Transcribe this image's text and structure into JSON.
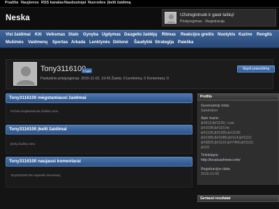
{
  "topnav": {
    "items": [
      "Pradžia",
      "Naujienos",
      "RSS kanalas",
      "Nauduotojai",
      "Nuorodos",
      "Įkelti žaidimą"
    ]
  },
  "header": {
    "logo": "Neska"
  },
  "promo": {
    "title": "Užsiregistruok ir gauk taškų!",
    "subtitle": "Prisijungimas · Registracija"
  },
  "menu": {
    "row1": [
      "Visi žaidimai",
      "Kiti",
      "Veiksmas",
      "Stalo",
      "Gynyba",
      "Ugdymas",
      "Daugelio žaidėjų",
      "Ritmas",
      "Reakcijos greitis",
      "Nuotykis",
      "Kazino",
      "Rengtis"
    ],
    "row2": [
      "Mušimės",
      "Vaidmenų",
      "Sportas",
      "Arkada",
      "Lenktynės",
      "Dėlionė",
      "Šaudyklė",
      "Strategija",
      "Paieška"
    ]
  },
  "profile": {
    "name": "Tony3116100",
    "badge": "0 lygis",
    "stats": "Paskutinis prisijungimas: 2015-11-02, 19:43   Žaista: 0   Įvertinimų: 0   Komentarų: 0",
    "message_button": "Siųsti pranešimą"
  },
  "sections": {
    "favorites_title": "Tony3116100 mėgstamiausi žaidimai",
    "favorites_empty": "Kol kas mėgstamiausių žaidimų nėra",
    "uploaded_title": "Tony3116100 įkelti žaidimai",
    "uploaded_empty": "Įkeltų žaidimų nėra",
    "comments_title": "Tony3116100 naujausi komentarai",
    "comments_empty": "Tony3116100 dar neparašė komentarų"
  },
  "sidebar": {
    "profile_title": "Profilis",
    "city_label": "Gyvenamoji vieta:",
    "city_value": "Sandviken",
    "about_label": "Apie mane:",
    "about_lines": [
      "&#913;&#1109; i can",
      "&#1098;&#116;he",
      "&#1109;&#1995;&#1109;",
      "&#1389;&#1086;&#114;&#1110;",
      "&#9825;&#1110;&#7456;&#1110;",
      "&#10"
    ],
    "website_label": "Tinklalapis:",
    "website_value": "http://localcashnow.com/",
    "registered_label": "Registracijos data:",
    "registered_value": "2015-11-02",
    "latest_title": "Geriausi rezultatai"
  }
}
